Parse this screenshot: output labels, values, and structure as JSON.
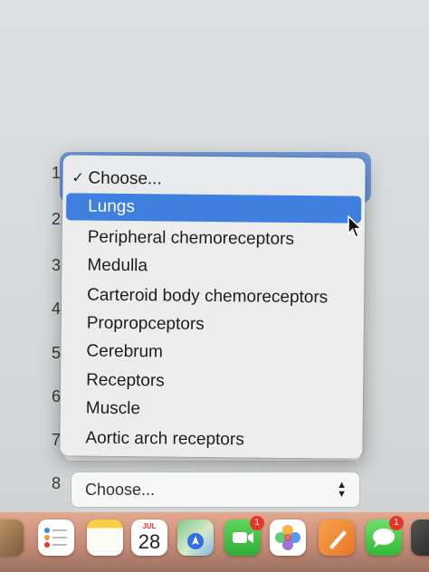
{
  "row_numbers": [
    "1",
    "2",
    "3",
    "4",
    "5",
    "6",
    "7",
    "8"
  ],
  "menu": {
    "check_mark": "✓",
    "items": [
      {
        "label": "Choose...",
        "selected": true
      },
      {
        "label": "Lungs",
        "highlighted": true
      },
      {
        "label": "Peripheral chemoreceptors"
      },
      {
        "label": "Medulla"
      },
      {
        "label": "Carteroid body chemoreceptors"
      },
      {
        "label": "Propropceptors"
      },
      {
        "label": "Cerebrum"
      },
      {
        "label": "Receptors"
      },
      {
        "label": "Muscle"
      },
      {
        "label": "Aortic arch receptors"
      }
    ]
  },
  "bottom_select": {
    "value": "Choose...",
    "up": "▲",
    "down": "▼"
  },
  "dock": {
    "calendar_month": "JUL",
    "calendar_day": "28",
    "facetime_badge": "1",
    "messages_badge": "1",
    "icons": [
      "launchpad-icon",
      "reminders-icon",
      "notes-icon",
      "calendar-icon",
      "maps-icon",
      "facetime-icon",
      "photos-icon",
      "pages-icon",
      "messages-icon",
      "app-icon"
    ]
  },
  "colors": {
    "highlight": "#3f7fe0",
    "focus_ring": "#5b8fd8",
    "badge": "#e8352c"
  }
}
